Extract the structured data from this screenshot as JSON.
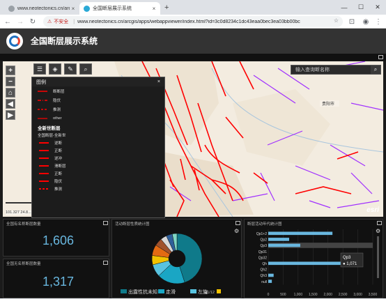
{
  "browser": {
    "tabs": [
      {
        "title": "www.neotectonics.cn/arcgis/p",
        "close": "×"
      },
      {
        "title": "全国断层展示系统",
        "close": "×"
      }
    ],
    "new_tab": "+",
    "window_controls": [
      "—",
      "☐",
      "✕"
    ],
    "security_label": "不安全",
    "url": "www.neotectonics.cn/arcgis/apps/webappviewer/index.html?id=3c0d8234c1dc43eaa0bec3ea03bb00bc"
  },
  "app": {
    "title": "全国断层展示系统",
    "search_placeholder": "输入查询断名称",
    "map": {
      "coordinates": "101.327 24.8...",
      "scale": "100km",
      "esri": "esri",
      "city_label": "贵阳市"
    },
    "legend": {
      "title": "图例",
      "close": "×",
      "items": [
        {
          "label": "断断层"
        },
        {
          "label": "隐伏"
        },
        {
          "label": "推测"
        },
        {
          "label": "other"
        }
      ],
      "section_title": "全新世断层",
      "section_sub": "全国断层-全新世",
      "sub_items": [
        "逆断",
        "正断",
        "走滑",
        "滑断层",
        "逆冲",
        "正断",
        "隐伏",
        "推测"
      ]
    },
    "panels": {
      "named_faults_label": "全国有名称断层数量",
      "named_faults_value": "1,606",
      "unnamed_faults_label": "全国无名称断层数量",
      "unnamed_faults_value": "1,317",
      "pie_title": "活动断层性质统计图",
      "pie_legend": [
        "出露性抗未知",
        "走滑",
        "左旋"
      ],
      "pie_pager": "1/12",
      "bar_title": "断层活动年代统计图",
      "tooltip_label": "Qp3",
      "tooltip_value": "1,071"
    }
  },
  "colors": {
    "fault": "#ff0000",
    "purple": "#a02fff",
    "accent": "#69b7df"
  },
  "chart_data": [
    {
      "type": "pie",
      "title": "活动断层性质统计图",
      "slices": [
        {
          "name": "出露性抗未知",
          "value": 45,
          "color": "#0f7a8a"
        },
        {
          "name": "走滑",
          "value": 18,
          "color": "#1aa6c4"
        },
        {
          "name": "左旋",
          "value": 8,
          "color": "#58c3e0"
        },
        {
          "name": "",
          "value": 6,
          "color": "#f2c200"
        },
        {
          "name": "",
          "value": 7,
          "color": "#e36a12"
        },
        {
          "name": "",
          "value": 5,
          "color": "#a0522d"
        },
        {
          "name": "",
          "value": 4,
          "color": "#d8d8d8"
        },
        {
          "name": "",
          "value": 4,
          "color": "#2f5f9a"
        },
        {
          "name": "",
          "value": 3,
          "color": "#7fd6c4"
        }
      ]
    },
    {
      "type": "bar",
      "title": "断层活动年代统计图",
      "categories": [
        "Qp1+2",
        "Qp2",
        "Qp3",
        "Qp31",
        "Qp32",
        "Qh",
        "Qh2",
        "Qh3",
        "null"
      ],
      "values": [
        2150,
        700,
        1071,
        0,
        0,
        2750,
        0,
        180,
        120
      ],
      "xticks": [
        "0",
        "500",
        "1,000",
        "1,500",
        "2,000",
        "2,500",
        "3,000",
        "3,500"
      ],
      "xlim": [
        0,
        3500
      ]
    }
  ]
}
